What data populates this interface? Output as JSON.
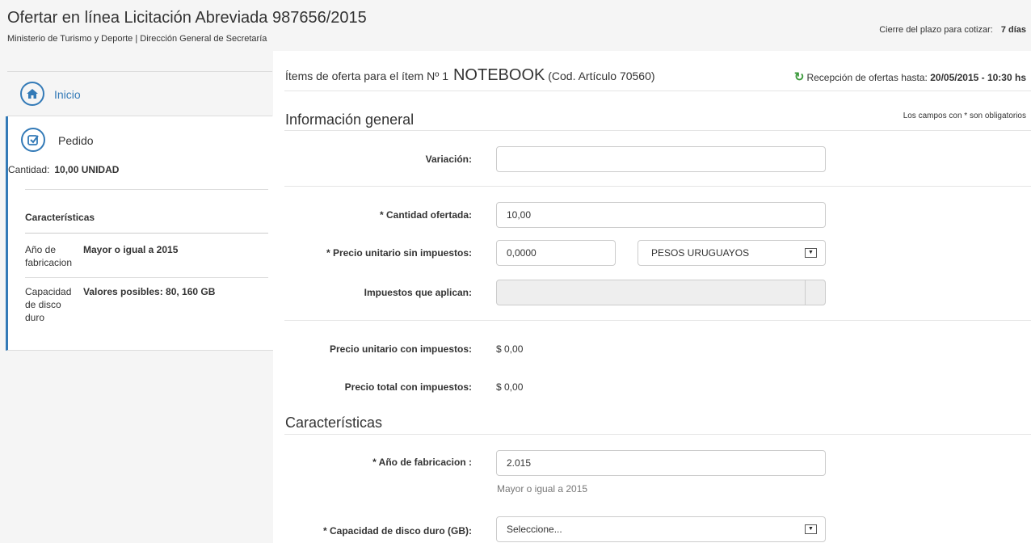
{
  "header": {
    "title": "Ofertar en línea Licitación Abreviada 987656/2015",
    "subtitle": "Ministerio de Turismo y Deporte | Dirección General de Secretaría",
    "deadline_label": "Cierre del plazo para cotizar:",
    "deadline_value": "7 días"
  },
  "sidebar": {
    "inicio": {
      "label": "Inicio",
      "icon": "home-icon"
    },
    "pedido": {
      "label": "Pedido",
      "icon": "checkbox-icon",
      "cantidad_label": "Cantidad:",
      "cantidad_value": "10,00 UNIDAD",
      "caracteristicas_title": "Características",
      "caracteristicas": [
        {
          "name": "Año de fabricacion",
          "value": "Mayor o igual a 2015"
        },
        {
          "name": "Capacidad de disco duro",
          "value": "Valores posibles: 80, 160 GB"
        }
      ]
    }
  },
  "main": {
    "item_prefix": "Ítems de oferta para el ítem Nº 1",
    "item_name": "NOTEBOOK",
    "item_code": "(Cod. Artículo 70560)",
    "reception_label": "Recepción de ofertas hasta:",
    "reception_value": "20/05/2015 - 10:30 hs",
    "reception_icon": "refresh-icon",
    "general_title": "Información general",
    "required_note": "Los campos con * son obligatorios",
    "fields": {
      "variacion": {
        "label": "Variación:",
        "value": ""
      },
      "cantidad": {
        "label": "* Cantidad ofertada:",
        "value": "10,00"
      },
      "precio": {
        "label": "* Precio unitario sin impuestos:",
        "value": "0,0000",
        "currency": "PESOS URUGUAYOS"
      },
      "impuestos": {
        "label": "Impuestos que aplican:",
        "value": ""
      },
      "precio_con": {
        "label": "Precio unitario con impuestos:",
        "value": "$ 0,00"
      },
      "total_con": {
        "label": "Precio total con impuestos:",
        "value": "$ 0,00"
      }
    },
    "caracteristicas_title": "Características",
    "car_fields": {
      "anio": {
        "label": "* Año de fabricacion :",
        "value": "2.015",
        "helper": "Mayor o igual a 2015"
      },
      "disco": {
        "label": "* Capacidad de disco duro (GB):",
        "placeholder": "Seleccione..."
      }
    }
  },
  "colors": {
    "accent": "#337ab7",
    "refresh": "#3c9a3c",
    "sidebar_bg": "#f5f5f5"
  }
}
